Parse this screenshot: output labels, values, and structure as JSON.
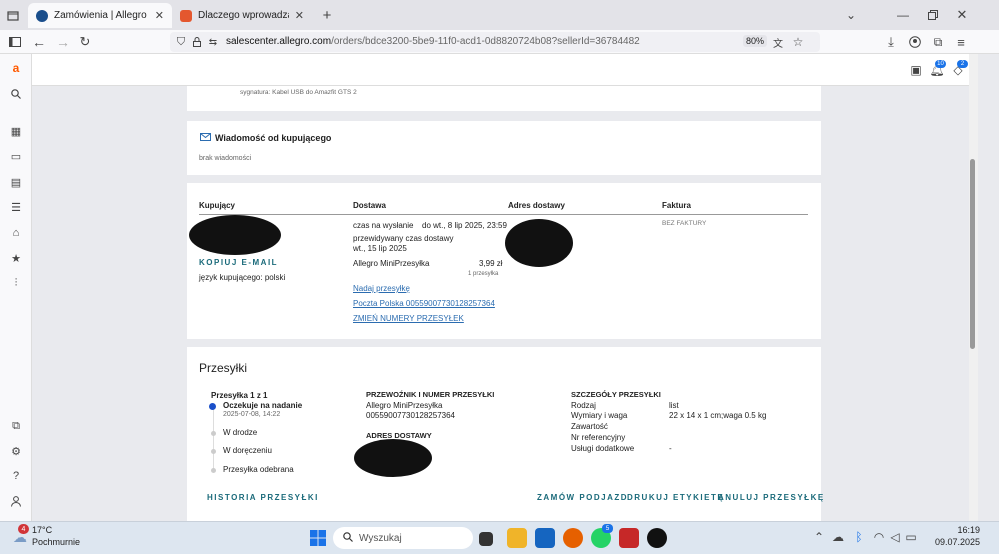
{
  "browser": {
    "tabs": [
      {
        "title": "Zamówienia | Allegro Sales Cen",
        "active": true,
        "color": "#1a4e8c"
      },
      {
        "title": "Dlaczego wprowadzacie klientów",
        "active": false,
        "color": "#e4572e"
      }
    ],
    "url_domain": "salescenter.allegro.com",
    "url_path": "/orders/bdce3200-5be9-11f0-acd1-0d8820724b08?sellerId=36784482",
    "zoom": "80%"
  },
  "header": {
    "messages_badge": "",
    "notif_badge": "10",
    "alerts_badge": "2"
  },
  "signature_row": {
    "text": "sygnatura: Kabel USB do Amazfit GTS 2"
  },
  "message_card": {
    "title": "Wiadomość od kupującego",
    "empty": "brak wiadomości"
  },
  "order_card": {
    "columns": {
      "buyer": "Kupujący",
      "delivery": "Dostawa",
      "address": "Adres dostawy",
      "invoice": "Faktura"
    },
    "copy_email": "KOPIUJ E-MAIL",
    "buyer_language": "język kupującego: polski",
    "ship_time_label": "czas na wysłanie",
    "ship_time_value": "do wt., 8 lip 2025, 23:59",
    "expected_label": "przewidywany czas dostawy",
    "expected_value": "wt., 15 lip 2025",
    "method": "Allegro MiniPrzesyłka",
    "price": "3,99 zł",
    "parcels": "1 przesyłka",
    "link_ship": "Nadaj przesyłkę",
    "link_tracking": "Poczta Polska 00559007730128257364",
    "link_change": "ZMIEŃ NUMERY PRZESYŁEK",
    "invoice_value": "BEZ FAKTURY"
  },
  "shipments_card": {
    "title": "Przesyłki",
    "count": "Przesyłka 1 z 1",
    "timeline": [
      {
        "label": "Oczekuje na nadanie",
        "date": "2025-07-08, 14:22",
        "active": true
      },
      {
        "label": "W drodze",
        "date": "",
        "active": false
      },
      {
        "label": "W doręczeniu",
        "date": "",
        "active": false
      },
      {
        "label": "Przesyłka odebrana",
        "date": "",
        "active": false
      }
    ],
    "carrier_header": "PRZEWOŹNIK I NUMER PRZESYŁKI",
    "carrier": "Allegro MiniPrzesyłka",
    "tracking": "00559007730128257364",
    "address_header": "ADRES DOSTAWY",
    "details_header": "SZCZEGÓŁY PRZESYŁKI",
    "details": [
      {
        "k": "Rodzaj",
        "v": "list"
      },
      {
        "k": "Wymiary i waga",
        "v": "22 x 14 x 1 cm;waga 0.5 kg"
      },
      {
        "k": "Zawartość",
        "v": ""
      },
      {
        "k": "Nr referencyjny",
        "v": ""
      },
      {
        "k": "Usługi dodatkowe",
        "v": "-"
      }
    ],
    "actions": {
      "history": "HISTORIA PRZESYŁKI",
      "order_pickup": "ZAMÓW PODJAZD",
      "print_label": "DRUKUJ ETYKIETĘ",
      "cancel": "ANULUJ PRZESYŁKĘ"
    }
  },
  "taskbar": {
    "weather_temp": "17°C",
    "weather_desc": "Pochmurnie",
    "weather_badge": "4",
    "search_placeholder": "Wyszukaj",
    "whatsapp_badge": "5",
    "time": "16:19",
    "date": "09.07.2025"
  },
  "colors": {
    "accent": "#ff5a00",
    "link": "#2b6cb0",
    "caps": "#1a6a7a",
    "timeline_active": "#1a4fc9"
  }
}
